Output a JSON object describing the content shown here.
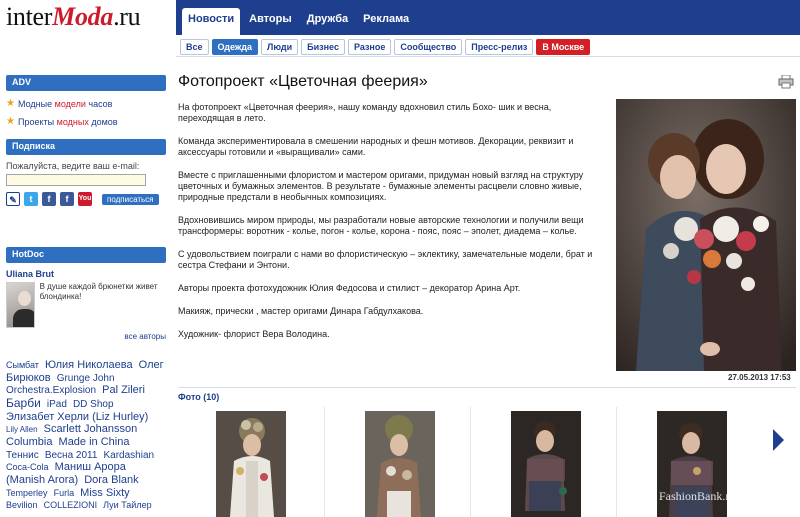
{
  "logo": {
    "text_part1": "inter",
    "text_part2": "Moda",
    "text_part3": ".ru"
  },
  "main_tabs": [
    {
      "label": "Новости"
    },
    {
      "label": "Авторы"
    },
    {
      "label": "Дружба"
    },
    {
      "label": "Реклама"
    }
  ],
  "sub_tabs": [
    {
      "label": "Все"
    },
    {
      "label": "Одежда"
    },
    {
      "label": "Люди"
    },
    {
      "label": "Бизнес"
    },
    {
      "label": "Разное"
    },
    {
      "label": "Сообщество"
    },
    {
      "label": "Пресс-релиз"
    },
    {
      "label": "В Москве"
    }
  ],
  "sidebar": {
    "adv": {
      "title": "ADV",
      "items": [
        {
          "part1": "Модные",
          "part2": "модели",
          "part3": "часов"
        },
        {
          "part1": "Проекты",
          "part2": "модных",
          "part3": "домов"
        }
      ]
    },
    "subscribe": {
      "title": "Подписка",
      "prompt": "Пожалуйста, ведите ваш e-mail:",
      "email_value": "",
      "button": "подписаться",
      "youtube_label": "You"
    },
    "hotdoc": {
      "title": "HotDoc",
      "author": "Uliana Brut",
      "text": "В душе каждой брюнетки живет блондинка!",
      "all_link": "все авторы"
    },
    "tags": [
      {
        "text": "Сымбат",
        "size": "t9"
      },
      {
        "text": "Юлия Николаева",
        "size": "t11"
      },
      {
        "text": "Олег Бирюков",
        "size": "t11"
      },
      {
        "text": "Grunge John Orchestra.Explosion",
        "size": "t10"
      },
      {
        "text": "Pal Zileri",
        "size": "t11"
      },
      {
        "text": "Барби",
        "size": "t12"
      },
      {
        "text": "iPad",
        "size": "t10"
      },
      {
        "text": "DD Shop",
        "size": "t10"
      },
      {
        "text": "Элизабет Херли (Liz Hurley)",
        "size": "t11"
      },
      {
        "text": "Lily Allen",
        "size": "t8"
      },
      {
        "text": "Scarlett Johansson",
        "size": "t11"
      },
      {
        "text": "Columbia",
        "size": "t11"
      },
      {
        "text": "Made in China",
        "size": "t11"
      },
      {
        "text": "Теннис",
        "size": "t10"
      },
      {
        "text": "Весна 2011",
        "size": "t10"
      },
      {
        "text": "Kardashian",
        "size": "t10"
      },
      {
        "text": "Coca-Cola",
        "size": "t9"
      },
      {
        "text": "Маниш Арора (Manish Arora)",
        "size": "t11"
      },
      {
        "text": "Dora Blank",
        "size": "t11"
      },
      {
        "text": "Temperley",
        "size": "t9"
      },
      {
        "text": "Furla",
        "size": "t9"
      },
      {
        "text": "Miss Sixty",
        "size": "t11"
      },
      {
        "text": "Bevilion",
        "size": "t9"
      },
      {
        "text": "COLLEZIONI",
        "size": "t9"
      },
      {
        "text": "Луи Тайлер",
        "size": "t9"
      }
    ]
  },
  "article": {
    "title": "Фотопроект «Цветочная феерия»",
    "paragraphs": [
      "На фотопроект «Цветочная феерия», нашу команду вдохновил стиль Бохо- шик и весна, переходящая в лето.",
      "Команда экспериментировала в смешении народных и фешн мотивов. Декорации, реквизит и аксессуары готовили и «выращивали» сами.",
      "Вместе с приглашенными флористом и мастером оригами, придуман новый взгляд на структуру цветочных и бумажных элементов. В результате - бумажные элементы расцвели словно живые, природные предстали в необычных композициях.",
      "Вдохновившись миром природы, мы разработали новые авторские технологии и получили вещи трансформеры: воротник - колье, погон - колье, корона - пояс, пояс – эполет, диадема – колье.",
      "С удовольствием поиграли с нами во флористическую – эклектику, замечательные модели, брат и сестра Стефани и Энтони.",
      "Авторы проекта фотохудожник Юлия Федосова и стилист – декоратор Арина Арт.",
      "Макияж, прически , мастер оригами Динара Габдулхакова.",
      "Художник- флорист Вера Володина."
    ],
    "date": "27.05.2013 17:53",
    "photos_label": "Фото (10)",
    "watermark": "FashionBank.ru"
  },
  "colors": {
    "brand_blue": "#1e3f8e",
    "accent_blue": "#2f6fc0",
    "brand_red": "#cc1b2c",
    "moscow_red": "#d41f26"
  }
}
